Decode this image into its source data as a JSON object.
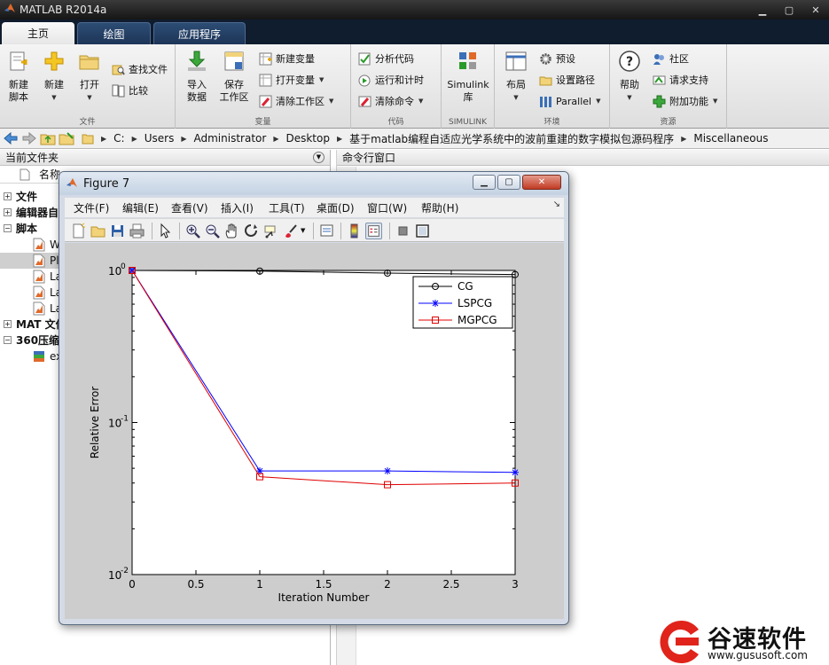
{
  "app": {
    "title": "MATLAB R2014a"
  },
  "tabs": [
    {
      "label": "主页",
      "active": true
    },
    {
      "label": "绘图",
      "active": false
    },
    {
      "label": "应用程序",
      "active": false
    }
  ],
  "ribbon": {
    "file": {
      "name": "文件",
      "new_script": [
        "新建",
        "脚本"
      ],
      "new": "新建",
      "open": "打开",
      "find_files": "查找文件",
      "compare": "比较"
    },
    "variable": {
      "name": "变量",
      "import": [
        "导入",
        "数据"
      ],
      "save": [
        "保存",
        "工作区"
      ],
      "new_var": "新建变量",
      "open_var": "打开变量",
      "clear_ws": "清除工作区"
    },
    "code": {
      "name": "代码",
      "analyze": "分析代码",
      "run_time": "运行和计时",
      "clear_cmd": "清除命令"
    },
    "simulink": {
      "name": "SIMULINK",
      "library": [
        "Simulink",
        "库"
      ]
    },
    "env": {
      "name": "环境",
      "layout": "布局",
      "prefs": "预设",
      "set_path": "设置路径",
      "parallel": "Parallel"
    },
    "resources": {
      "name": "资源",
      "help": "帮助",
      "community": "社区",
      "support": "请求支持",
      "addons": "附加功能"
    }
  },
  "address": {
    "crumbs": [
      "C:",
      "Users",
      "Administrator",
      "Desktop",
      "基于matlab编程自适应光学系统中的波前重建的数字模拟包源码程序",
      "Miscellaneous"
    ]
  },
  "left_panel": {
    "title": "当前文件夹",
    "column": "名称",
    "tree": [
      {
        "type": "group",
        "label": "文件",
        "expanded": false
      },
      {
        "type": "group",
        "label": "编辑器自",
        "expanded": false
      },
      {
        "type": "group",
        "label": "脚本",
        "expanded": true
      },
      {
        "type": "file",
        "label": "W",
        "selected": false
      },
      {
        "type": "file",
        "label": "Pl",
        "selected": true
      },
      {
        "type": "file",
        "label": "La",
        "selected": false
      },
      {
        "type": "file",
        "label": "La",
        "selected": false
      },
      {
        "type": "file",
        "label": "La",
        "selected": false
      },
      {
        "type": "group",
        "label": "MAT 文件",
        "expanded": false
      },
      {
        "type": "group",
        "label": "360压缩",
        "expanded": true
      },
      {
        "type": "file",
        "label": "ex",
        "selected": false,
        "icon": "archive"
      }
    ]
  },
  "cmd_panel": {
    "title": "命令行窗口"
  },
  "figure": {
    "title": "Figure 7",
    "menu": [
      "文件(F)",
      "编辑(E)",
      "查看(V)",
      "插入(I)",
      "工具(T)",
      "桌面(D)",
      "窗口(W)",
      "帮助(H)"
    ]
  },
  "chart_data": {
    "type": "line",
    "xlabel": "Iteration Number",
    "ylabel": "Relative Error",
    "xlim": [
      0,
      3
    ],
    "ylim": [
      0.01,
      1
    ],
    "yscale": "log",
    "x_ticks": [
      0,
      0.5,
      1,
      1.5,
      2,
      2.5,
      3
    ],
    "x_tick_labels": [
      "0",
      "0.5",
      "1",
      "1.5",
      "2",
      "2.5",
      "3"
    ],
    "y_ticks": [
      0.01,
      0.1,
      1
    ],
    "y_tick_labels": [
      {
        "base": "10",
        "exp": "-2"
      },
      {
        "base": "10",
        "exp": "-1"
      },
      {
        "base": "10",
        "exp": "0"
      }
    ],
    "legend_position": "top-right",
    "x": [
      0,
      1,
      2,
      3
    ],
    "series": [
      {
        "name": "CG",
        "color": "#000000",
        "marker": "circle",
        "values": [
          1.0,
          0.99,
          0.96,
          0.94
        ]
      },
      {
        "name": "LSPCG",
        "color": "#0000ff",
        "marker": "star",
        "values": [
          1.0,
          0.048,
          0.048,
          0.047
        ]
      },
      {
        "name": "MGPCG",
        "color": "#e00000",
        "marker": "square",
        "values": [
          1.0,
          0.044,
          0.039,
          0.04
        ]
      }
    ]
  },
  "watermark": {
    "text": "谷速软件",
    "url": "www.gususoft.com"
  },
  "colors": {
    "ribbon_tab_bg": "#101d2f",
    "window_frame": "#d4dbe6",
    "axes_bg": "#ffffff",
    "figure_bg": "#cdcdcd",
    "watermark_red": "#e0241b"
  }
}
